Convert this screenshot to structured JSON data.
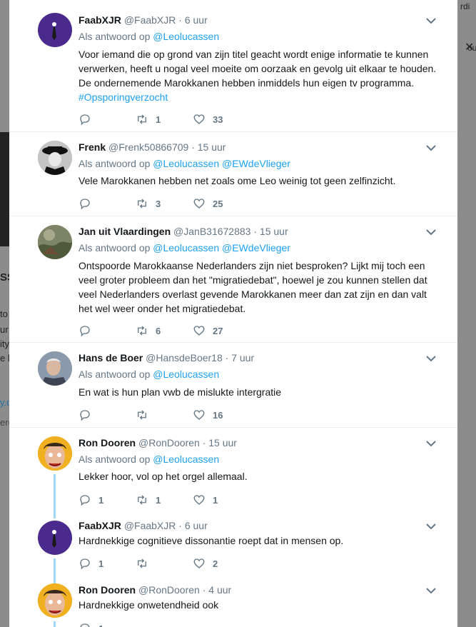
{
  "tweets": [
    {
      "name": "FaabXJR",
      "handle": "@FaabXJR",
      "time": "6 uur",
      "reply_prefix": "Als antwoord op",
      "reply_mentions": [
        "@Leolucassen"
      ],
      "text": "Voor iemand die op grond van zijn titel geacht wordt enige informatie te kunnen verwerken, heeft u nogal veel moeite om oorzaak en gevolg uit elkaar te houden. De ondernemende Marokkanen hebben inmiddels hun eigen tv programma.",
      "hashtag": "#Opsporingverzocht",
      "replies": "",
      "retweets": "1",
      "likes": "33",
      "avatar": "faab-avatar"
    },
    {
      "name": "Frenk",
      "handle": "@Frenk50866709",
      "time": "15 uur",
      "reply_prefix": "Als antwoord op",
      "reply_mentions": [
        "@Leolucassen",
        "@EWdeVlieger"
      ],
      "text": "Vele Marokkanen hebben net zoals ome Leo weinig tot geen zelfinzicht.",
      "replies": "",
      "retweets": "3",
      "likes": "25",
      "avatar": "frenk-avatar"
    },
    {
      "name": "Jan uit Vlaardingen",
      "handle": "@JanB31672883",
      "time": "15 uur",
      "reply_prefix": "Als antwoord op",
      "reply_mentions": [
        "@Leolucassen",
        "@EWdeVlieger"
      ],
      "text": "Ontspoorde Marokkaanse Nederlanders zijn niet besproken? Lijkt mij toch een veel groter probleem dan het \"migratiedebat\", hoewel je zou kunnen stellen dat veel Nederlanders overlast gevende Marokkanen meer dan zat zijn en dan valt het wel weer onder het migratiedebat.",
      "replies": "",
      "retweets": "6",
      "likes": "27",
      "avatar": "jan-avatar"
    },
    {
      "name": "Hans de Boer",
      "handle": "@HansdeBoer18",
      "time": "7 uur",
      "reply_prefix": "Als antwoord op",
      "reply_mentions": [
        "@Leolucassen"
      ],
      "text": "En wat is hun plan vwb de mislukte intergratie",
      "replies": "",
      "retweets": "",
      "likes": "16",
      "avatar": "hans-avatar"
    },
    {
      "name": "Ron Dooren",
      "handle": "@RonDooren",
      "time": "15 uur",
      "reply_prefix": "Als antwoord op",
      "reply_mentions": [
        "@Leolucassen"
      ],
      "text": "Lekker hoor, vol op het orgel allemaal.",
      "replies": "1",
      "retweets": "1",
      "likes": "1",
      "avatar": "ron-avatar"
    },
    {
      "name": "FaabXJR",
      "handle": "@FaabXJR",
      "time": "6 uur",
      "text": "Hardnekkige cognitieve dissonantie roept dat in mensen op.",
      "replies": "1",
      "retweets": "",
      "likes": "2",
      "avatar": "faab-avatar"
    },
    {
      "name": "Ron Dooren",
      "handle": "@RonDooren",
      "time": "4 uur",
      "text": "Hardnekkige onwetendheid ook",
      "replies": "1",
      "retweets": "",
      "likes": "",
      "avatar": "ron-avatar"
    }
  ],
  "background": {
    "left_fragments": [
      "SS",
      "to",
      "ur",
      "ity",
      "e l",
      "y.c",
      "erc"
    ],
    "right_fragments": [
      "rdi",
      "our"
    ]
  },
  "colors": {
    "link": "#1da1f2",
    "meta": "#657786",
    "thread": "#9fd5f7"
  }
}
